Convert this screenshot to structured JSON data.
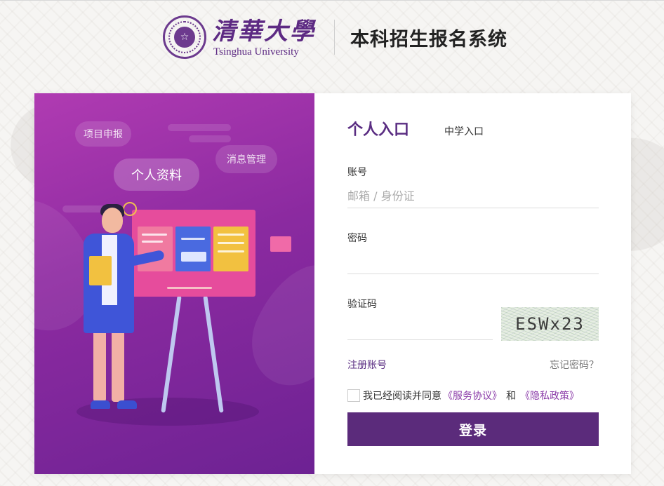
{
  "header": {
    "university_cn": "清華大學",
    "university_en": "Tsinghua University",
    "seal_glyph": "☆",
    "system_title": "本科招生报名系统"
  },
  "illustration": {
    "bubbles": [
      "项目申报",
      "个人资料",
      "消息管理"
    ]
  },
  "login": {
    "tab_personal": "个人入口",
    "tab_school": "中学入口",
    "account_label": "账号",
    "account_placeholder": "邮箱 / 身份证",
    "password_label": "密码",
    "captcha_label": "验证码",
    "captcha_text": "ESWx23",
    "register_link": "注册账号",
    "forgot_link": "忘记密码？",
    "agree_text": "我已经阅读并同意",
    "service_agreement": "《服务协议》",
    "and_text": "和",
    "privacy_policy": "《隐私政策》",
    "login_button": "登录"
  },
  "colors": {
    "brand_purple": "#5b2b7b",
    "illus_gradient_start": "#b03bb2",
    "illus_gradient_end": "#6d2293"
  }
}
